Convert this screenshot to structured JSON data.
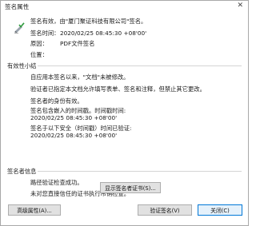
{
  "window": {
    "title": "签名属性",
    "close_glyph": "✕"
  },
  "header": {
    "status": "签名有效，由\"厦门聚证科技有限公司\"签名。",
    "time_label": "签名时间：",
    "time_value": "2020/02/25 08:45:30 +08'00'",
    "reason_label": "原因：",
    "reason_value": "PDF文件签名",
    "location_label": "位置："
  },
  "validity": {
    "title": "有效性小结",
    "lines": [
      "自应用本签名以来，\"文档\"未被修改。",
      "验证者已指定本文档允许填写表单、签名和注释，但禁止其它更改。",
      "签名者的身份有效。",
      "签名包含嵌入的时间戳。时间戳时间:",
      "2020/02/25 08:45:30 +08'00'",
      "签名于以下安全（时间戳）时间已验证:",
      "2020/02/25 08:45:30 +08'00'"
    ]
  },
  "signer": {
    "title": "签名者信息",
    "lines": [
      "路径验证检查成功。",
      "未对您直接信任的证书执行吊销检查。"
    ],
    "show_cert_button": "显示签名者证书(S)..."
  },
  "footer": {
    "advanced_button": "高级属性(A)...",
    "validate_button": "验证签名(V)",
    "close_button": "关闭(C)"
  },
  "icons": {
    "signature": "signature-valid-icon"
  },
  "colors": {
    "accent": "#0078d7",
    "check": "#2e9a3c"
  }
}
